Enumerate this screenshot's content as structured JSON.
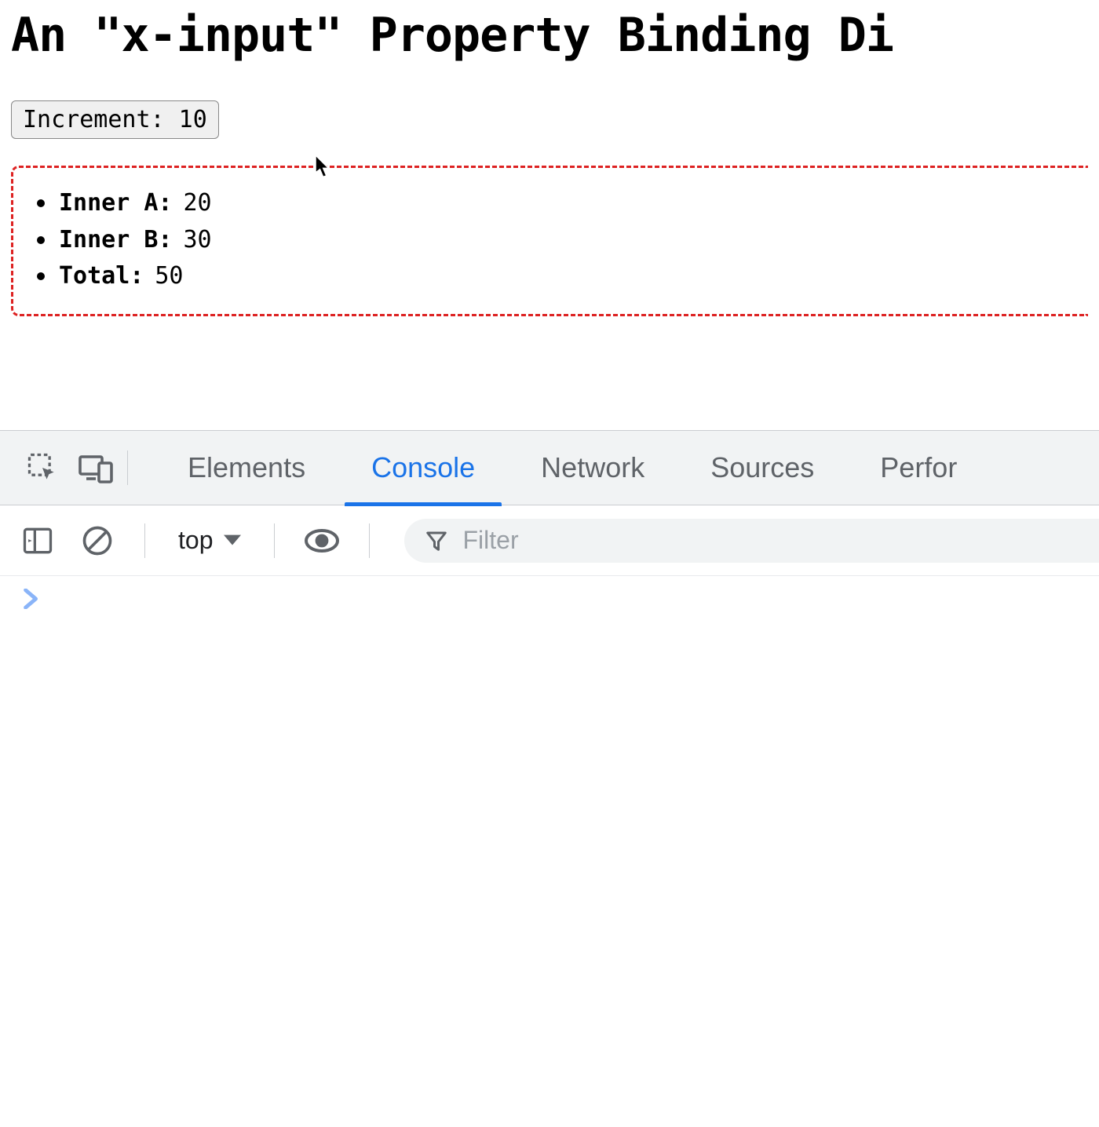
{
  "page": {
    "title": "An \"x-input\" Property Binding Di",
    "button_label": "Increment: 10",
    "items": [
      {
        "label": "Inner A:",
        "value": "20"
      },
      {
        "label": "Inner B:",
        "value": "30"
      },
      {
        "label": "Total:",
        "value": "50"
      }
    ]
  },
  "devtools": {
    "tabs": {
      "elements": "Elements",
      "console": "Console",
      "network": "Network",
      "sources": "Sources",
      "performance": "Perfor"
    },
    "active_tab": "console",
    "console": {
      "context": "top",
      "filter_placeholder": "Filter",
      "prompt": ">"
    }
  }
}
